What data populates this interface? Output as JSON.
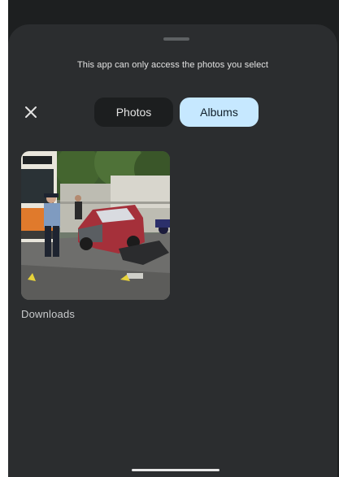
{
  "sheet": {
    "notice": "This app can only access the photos you select"
  },
  "tabs": [
    {
      "label": "Photos",
      "selected": false
    },
    {
      "label": "Albums",
      "selected": true
    }
  ],
  "albums": [
    {
      "name": "Downloads"
    }
  ],
  "colors": {
    "sheet_background": "#2b2d2f",
    "selected_tab": "#c6e8ff",
    "unselected_tab": "#1c1e1f"
  }
}
